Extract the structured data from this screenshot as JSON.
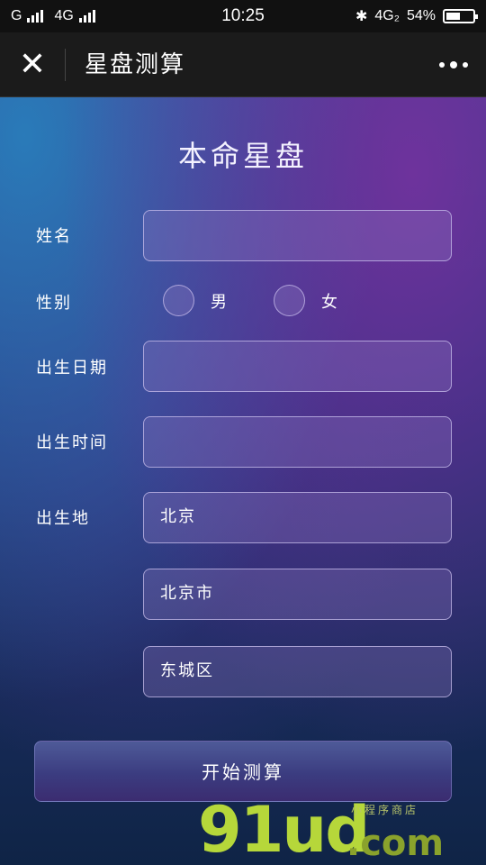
{
  "status_bar": {
    "carrier1": "G",
    "carrier2": "4G",
    "time": "10:25",
    "network": "4G₂",
    "battery": "54%",
    "battery_level": 0.54
  },
  "title_bar": {
    "title": "星盘测算"
  },
  "page": {
    "heading": "本命星盘"
  },
  "form": {
    "name_label": "姓名",
    "name_value": "",
    "gender_label": "性别",
    "gender_options": [
      "男",
      "女"
    ],
    "birth_date_label": "出生日期",
    "birth_date_value": "",
    "birth_time_label": "出生时间",
    "birth_time_value": "",
    "birth_place_label": "出生地",
    "province": "北京",
    "city": "北京市",
    "district": "东城区"
  },
  "submit_label": "开始测算",
  "watermark": {
    "main": "91ud",
    "domain": ".com",
    "sub": "小程序商店"
  }
}
